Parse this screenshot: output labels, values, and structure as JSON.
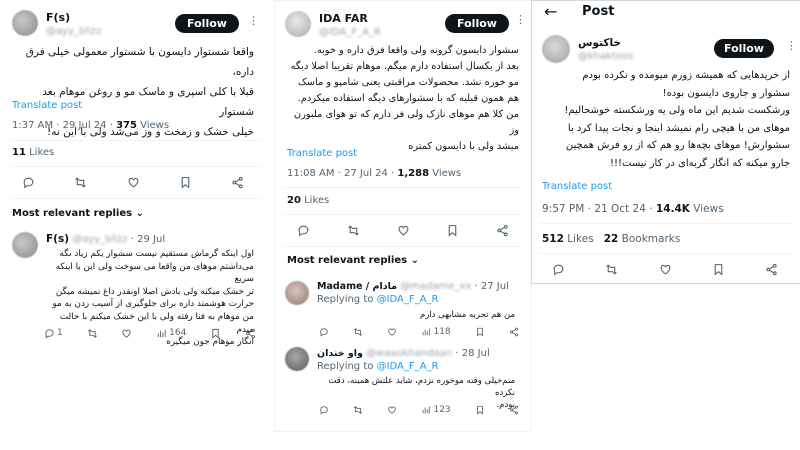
{
  "panel1": {
    "author": {
      "name": "F(s)",
      "handle": "@ayy_blizz"
    },
    "follow_label": "Follow",
    "more_icon": "more-icon",
    "text_lines": [
      "واقعا شستوار دایسون با شستوار معمولی خیلی فرق داره،",
      "قبلا با کلی اسپری و ماسک مو و روغن موهام بعد شستوار",
      "خیلی خشک و زمخت و وز می‌شد ولی با این نه!"
    ],
    "translate_label": "Translate post",
    "time": "1:37 AM · 29 Jul 24 · ",
    "views_count": "375",
    "views_label": " Views",
    "likes_count": "11",
    "likes_label": " Likes",
    "replies_header": "Most relevant replies",
    "reply": {
      "name": "F(s)",
      "handle": "@ayy_blizz",
      "date": "· 29 Jul",
      "text_lines": [
        "اول اینکه گرماش مستقیم نیست سشوار یکم زیاد نگه",
        "می‌داشتم موهای من واقعا می سوخت ولی این با اینکه  سریع",
        "تر خشک میکنه ولی بادش اصلا اونقدر داغ نمیشه میگن",
        "حرارت هوشمند داره برای جلوگیری از آسیب زدن به مو",
        "من موهام به فنا رفته ولی با این خشک میکنم با حالت میدم",
        "انگار موهام جون میگیره"
      ],
      "reply_count": "1",
      "views": "164"
    }
  },
  "panel2": {
    "author": {
      "name": "IDA FAR",
      "handle": "@IDA_F_A_R"
    },
    "follow_label": "Follow",
    "text_lines": [
      "سشوار دایسون گرونه ولی واقعا فرق داره و خوبه.",
      "بعد از یکسال استفاده دارم میگم. موهام تقریبا اصلا دیگه",
      "مو خوره نشد. محصولات مراقبتی یعنی شامپو و ماسک",
      "هم همون قبلیه که با سشوارهای دیگه استفاده میکردم.",
      "من کلا هم موهای نازک ولی فر دارم که تو هوای ملبورن وز",
      "میشد ولی با دایسون کمتره"
    ],
    "translate_label": "Translate post",
    "time": "11:08 AM · 27 Jul 24 · ",
    "views_count": "1,288",
    "views_label": " Views",
    "likes_count": "20",
    "likes_label": " Likes",
    "replies_header": "Most relevant replies",
    "replies": [
      {
        "name": "Madame / مادام",
        "handle": "@madame_xx",
        "date": "· 27 Jul",
        "replying_prefix": "Replying to ",
        "replying_to": "@IDA_F_A_R",
        "text": "من هم تجربه مشابهی دارم",
        "views": "118"
      },
      {
        "name": "واو خندان",
        "handle": "@waaokhandaan",
        "date": "· 28 Jul",
        "replying_prefix": "Replying to ",
        "replying_to": "@IDA_F_A_R",
        "text_lines": [
          "منم‌خیلی وقته موخوره نزدم، شاید علتش همینه، دقت نکرده",
          "بودم."
        ],
        "views": "123"
      }
    ]
  },
  "panel3": {
    "header_title": "Post",
    "author": {
      "name": "خاکتوس",
      "handle": "@khaktoos"
    },
    "follow_label": "Follow",
    "text_lines": [
      "از خریدهایی که همیشه زورم میومده و نکرده بودم",
      "سشوار و جاروی دایسون بوده!",
      "ورشکست شدیم این ماه ولی یه ورشکسته خوشحالیم!",
      "موهای من با هیچی رام نمیشد اینجا و نجات پیدا کرد با",
      "سشوارش! موهای بچه‌ها رو هم که از رو فرش همچین",
      "جارو میکنه که انگار گربه‌ای در کار نیست!!!"
    ],
    "translate_label": "Translate post",
    "time": "9:57 PM · 21 Oct 24 · ",
    "views_count": "14.4K",
    "views_label": " Views",
    "likes_count": "512",
    "likes_label": " Likes",
    "bookmarks_count": "22",
    "bookmarks_label": " Bookmarks"
  }
}
